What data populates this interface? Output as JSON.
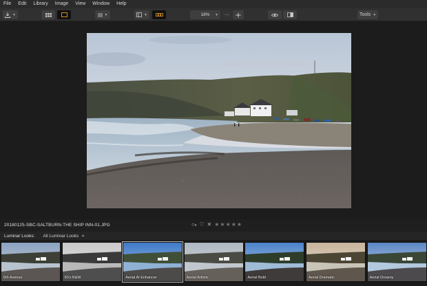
{
  "menu": [
    "File",
    "Edit",
    "Library",
    "Image",
    "View",
    "Window",
    "Help"
  ],
  "toolbar": {
    "zoom_value": "18%",
    "tools_label": "Tools",
    "fit_label": "···"
  },
  "image": {
    "filename": "20180125-SBC-SALTBURN-THE SHIP INN-01.JPG"
  },
  "looks": {
    "label": "Luminar Looks:",
    "selected": "All Luminar Looks",
    "items": [
      {
        "name": "5th Avenue",
        "style": "warm"
      },
      {
        "name": "60's B&W",
        "style": "bw"
      },
      {
        "name": "Aerial AI Enhancer",
        "style": "vivid"
      },
      {
        "name": "Aerial Artistic",
        "style": "muted"
      },
      {
        "name": "Aerial Bold",
        "style": "bold"
      },
      {
        "name": "Aerial Dramatic",
        "style": "dramatic"
      },
      {
        "name": "Aerial Dreamy",
        "style": "dreamy"
      }
    ]
  },
  "colors": {
    "accent_orange": "#e8a020"
  }
}
